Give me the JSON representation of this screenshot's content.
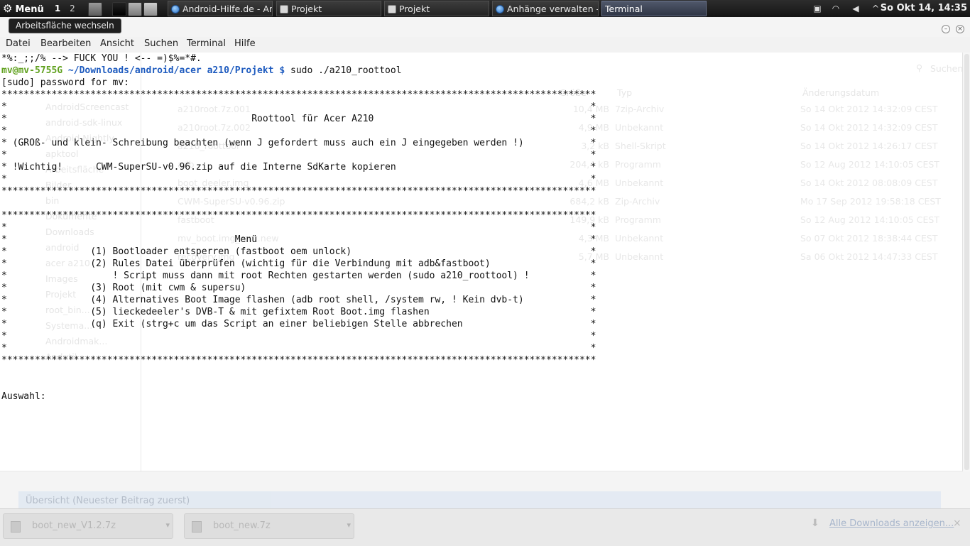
{
  "panel": {
    "menu_label": "Menü",
    "workspaces": [
      "1",
      "2"
    ],
    "tasks": [
      {
        "label": "Android-Hilfe.de - An...",
        "icon": "globe-icon"
      },
      {
        "label": "Projekt",
        "icon": "folder-icon"
      },
      {
        "label": "Projekt",
        "icon": "folder-icon"
      },
      {
        "label": "Anhänge verwalten -...",
        "icon": "globe-icon"
      },
      {
        "label": "Terminal",
        "icon": "terminal-icon",
        "active": true
      }
    ],
    "clock": "So Okt 14, 14:35"
  },
  "tooltip": "Arbeitsfläche wechseln",
  "terminal": {
    "menus": [
      "Datei",
      "Bearbeiten",
      "Ansicht",
      "Suchen",
      "Terminal",
      "Hilfe"
    ],
    "line_prev": "*%:_;;/% --> FUCK YOU ! <-- =)$%=*#.",
    "prompt_user": "mv@mv-5755G",
    "prompt_path": " ~/Downloads/android/acer a210/Projekt $",
    "command": " sudo ./a210_roottool",
    "output": "[sudo] password for mv:\n***********************************************************************************************************\n*                                                                                                         *\n*                                            Roottool für Acer A210                                       *\n*                                                                                                         *\n* (GROß- und klein- Schreibung beachten (wenn J gefordert muss auch ein J eingegeben werden !)            *\n*                                                                                                         *\n* !Wichtig!      CWM-SuperSU-v0.96.zip auf die Interne SdKarte kopieren                                   *\n*                                                                                                         *\n***********************************************************************************************************\n\n***********************************************************************************************************\n*                                                                                                         *\n*                                         Menü                                                            *\n*               (1) Bootloader entsperren (fastboot oem unlock)                                           *\n*               (2) Rules Datei überprüfen (wichtig für die Verbindung mit adb&fastboot)                  *\n*                   ! Script muss dann mit root Rechten gestarten werden (sudo a210_roottool) !           *\n*               (3) Root (mit cwm & supersu)                                                              *\n*               (4) Alternatives Boot Image flashen (adb root shell, /system rw, ! Kein dvb-t)            *\n*               (5) lieckedeeler's DVB-T & mit gefixtem Root Boot.img flashen                             *\n*               (q) Exit (strg+c um das Script an einer beliebigen Stelle abbrechen                       *\n*                                                                                                         *\n*                                                                                                         *\n***********************************************************************************************************\n\n\nAuswahl: "
  },
  "background_browser": {
    "search_placeholder": "Suchen",
    "columns": [
      "Größe",
      "Typ",
      "Änderungsdatum"
    ],
    "tree": [
      "AndroidScreencast",
      "android-sdk-linux",
      "Android Nightly",
      "apktool",
      "Arbeitsfläche",
      "Bilder",
      "bin",
      "Dokumente",
      "Downloads",
      "android",
      "acer a210",
      "Images",
      "Projekt",
      "root_bin...",
      "Systema...",
      "Androidmak...",
      "Andutil"
    ],
    "files": [
      {
        "name": "a210root.7z.001",
        "size": "10,4 MB",
        "type": "7zip-Archiv",
        "date": "So 14 Okt 2012 14:32:09 CEST"
      },
      {
        "name": "a210root.7z.002",
        "size": "4,9 MB",
        "type": "Unbekannt",
        "date": "So 14 Okt 2012 14:32:09 CEST"
      },
      {
        "name": "a210_roottool",
        "size": "3,2 kB",
        "type": "Shell-Skript",
        "date": "So 14 Okt 2012 14:26:17 CEST"
      },
      {
        "name": "adb",
        "size": "204,4 kB",
        "type": "Programm",
        "date": "So 12 Aug 2012 14:10:05 CEST"
      },
      {
        "name": "boot_deeler.img",
        "size": "4,6 MB",
        "type": "Unbekannt",
        "date": "So 14 Okt 2012 08:08:09 CEST"
      },
      {
        "name": "CWM-SuperSU-v0.96.zip",
        "size": "684,2 kB",
        "type": "Zip-Archiv",
        "date": "Mo 17 Sep 2012 19:58:18 CEST"
      },
      {
        "name": "fastboot",
        "size": "149,9 kB",
        "type": "Programm",
        "date": "So 12 Aug 2012 14:10:05 CEST"
      },
      {
        "name": "mv_boot.img_root.new",
        "size": "4,3 MB",
        "type": "Unbekannt",
        "date": "So 07 Okt 2012 18:38:44 CEST"
      },
      {
        "name": "recovery.img",
        "size": "5,7 MB",
        "type": "Unbekannt",
        "date": "Sa 06 Okt 2012 14:47:33 CEST"
      }
    ],
    "forum_strip": "Übersicht (Neuester Beitrag zuerst)"
  },
  "downloads": {
    "items": [
      "boot_new_V1.2.7z",
      "boot_new.7z"
    ],
    "show_all": "Alle Downloads anzeigen..."
  }
}
